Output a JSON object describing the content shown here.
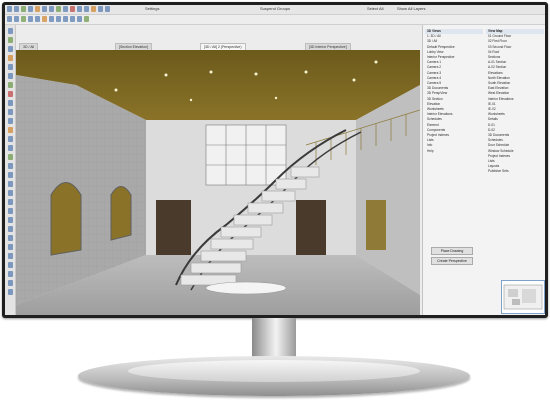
{
  "toolbar": {
    "items": [
      "Settings",
      "Suspend Groups",
      "Select All",
      "Show All Layers"
    ]
  },
  "tabs": [
    {
      "label": "3D / All"
    },
    {
      "label": "[Section Elevation]"
    },
    {
      "label": "[3D / All] 2 (Perspective)"
    },
    {
      "label": "[3D Interior Perspective]"
    }
  ],
  "navigator": {
    "left_items": [
      "3D Views",
      "1. 3D / All",
      "3D / All",
      "Default Perspective",
      "Lobby View",
      "Interior Perspective",
      "Camera 1",
      "Camera 2",
      "Camera 3",
      "Camera 4",
      "Camera 5",
      "3D Documents",
      "3D PerspView",
      "3D Section",
      "Elevation",
      "Worksheets",
      "Interior Elevations",
      "Schedules",
      "Element",
      "Components",
      "Project Indexes",
      "Lists",
      "Info",
      "Help"
    ],
    "right_items": [
      "View Map",
      "01 Ground Floor",
      "02 First Floor",
      "03 Second Floor",
      "04 Roof",
      "Sections",
      "A-01 Section",
      "A-02 Section",
      "Elevations",
      "North Elevation",
      "South Elevation",
      "East Elevation",
      "West Elevation",
      "Interior Elevations",
      "IE-01",
      "IE-02",
      "Worksheets",
      "Details",
      "D-01",
      "D-02",
      "3D Documents",
      "Schedules",
      "Door Schedule",
      "Window Schedule",
      "Project Indexes",
      "Lists",
      "Layouts",
      "Publisher Sets"
    ],
    "buttons": [
      "Place Drawing",
      "Create Perspective"
    ]
  }
}
